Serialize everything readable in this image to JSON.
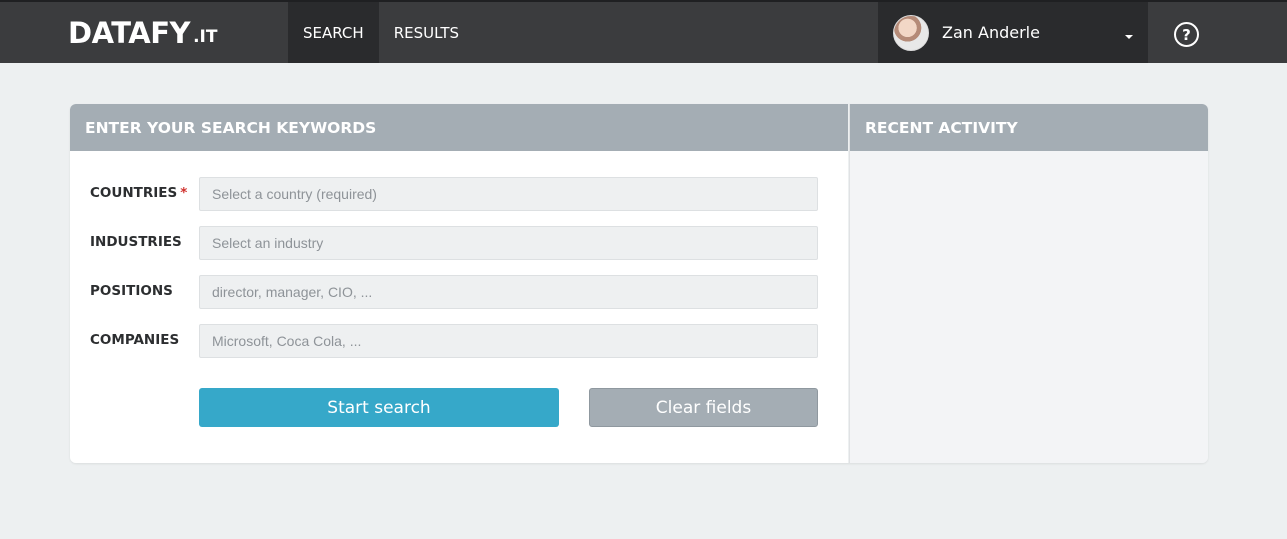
{
  "brand": {
    "main": "DATAFY",
    "ext": ".IT"
  },
  "nav": {
    "items": [
      {
        "label": "SEARCH"
      },
      {
        "label": "RESULTS"
      }
    ]
  },
  "user": {
    "name": "Zan Anderle"
  },
  "help": {
    "glyph": "?"
  },
  "search_panel": {
    "title": "ENTER YOUR SEARCH KEYWORDS",
    "fields": [
      {
        "label": "COUNTRIES",
        "required_marker": "*",
        "placeholder": "Select a country (required)"
      },
      {
        "label": "INDUSTRIES",
        "placeholder": "Select an industry"
      },
      {
        "label": "POSITIONS",
        "placeholder": "director, manager, CIO, ..."
      },
      {
        "label": "COMPANIES",
        "placeholder": "Microsoft, Coca Cola, ..."
      }
    ],
    "start_button": "Start search",
    "clear_button": "Clear fields"
  },
  "activity_panel": {
    "title": "RECENT ACTIVITY"
  },
  "colors": {
    "topbar": "#3b3c3e",
    "topbar_active": "#2a2b2d",
    "panel_header": "#a4adb4",
    "primary": "#36a8c9",
    "required": "#d0312d",
    "background": "#edf0f1"
  },
  "icons": {
    "help": "question-circle-icon",
    "dropdown": "caret-down-icon",
    "avatar": "user-avatar"
  }
}
